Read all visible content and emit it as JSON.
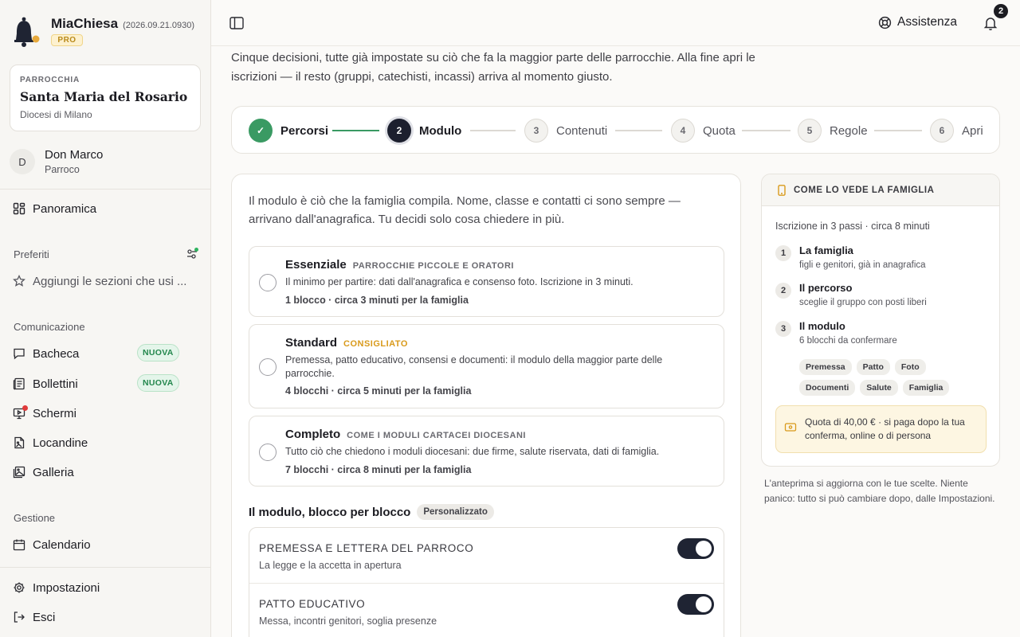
{
  "brand": {
    "name": "MiaChiesa",
    "version": "(2026.09.21.0930)",
    "badge": "PRO",
    "accent": "#1c1f2e",
    "gold": "#e7a93b"
  },
  "parish": {
    "kicker": "PARROCCHIA",
    "name": "Santa Maria del Rosario",
    "diocese": "Diocesi di Milano"
  },
  "user": {
    "initial": "D",
    "name": "Don Marco",
    "role": "Parroco"
  },
  "nav": {
    "overview": "Panoramica",
    "favorites_label": "Preferiti",
    "favorites_add": "Aggiungi le sezioni che usi ...",
    "communication_label": "Comunicazione",
    "communication": [
      {
        "label": "Bacheca",
        "badge": "NUOVA",
        "icon": "message-icon"
      },
      {
        "label": "Bollettini",
        "badge": "NUOVA",
        "icon": "newsletter-icon"
      },
      {
        "label": "Schermi",
        "icon": "screen-icon",
        "dot": true
      },
      {
        "label": "Locandine",
        "icon": "poster-icon"
      },
      {
        "label": "Galleria",
        "icon": "gallery-icon"
      }
    ],
    "management_label": "Gestione",
    "calendar": "Calendario",
    "settings": "Impostazioni",
    "logout": "Esci"
  },
  "topbar": {
    "help": "Assistenza",
    "notifications": "2"
  },
  "intro": "Cinque decisioni, tutte già impostate su ciò che fa la maggior parte delle parrocchie. Alla fine apri le iscrizioni — il resto (gruppi, catechisti, incassi) arriva al momento giusto.",
  "steps": [
    {
      "num": "✓",
      "label": "Percorsi",
      "state": "done"
    },
    {
      "num": "2",
      "label": "Modulo",
      "state": "active"
    },
    {
      "num": "3",
      "label": "Contenuti",
      "state": "todo"
    },
    {
      "num": "4",
      "label": "Quota",
      "state": "todo"
    },
    {
      "num": "5",
      "label": "Regole",
      "state": "todo"
    },
    {
      "num": "6",
      "label": "Apri",
      "state": "todo"
    }
  ],
  "module": {
    "intro": "Il modulo è ciò che la famiglia compila. Nome, classe e contatti ci sono sempre — arrivano dall'anagrafica. Tu decidi solo cosa chiedere in più.",
    "options": [
      {
        "name": "Essenziale",
        "tag": "PARROCCHIE PICCOLE E ORATORI",
        "desc": "Il minimo per partire: dati dall'anagrafica e consenso foto. Iscrizione in 3 minuti.",
        "meta": "1 blocco · circa 3 minuti per la famiglia"
      },
      {
        "name": "Standard",
        "tag": "CONSIGLIATO",
        "desc": "Premessa, patto educativo, consensi e documenti: il modulo della maggior parte delle parrocchie.",
        "meta": "4 blocchi · circa 5 minuti per la famiglia"
      },
      {
        "name": "Completo",
        "tag": "COME I MODULI CARTACEI DIOCESANI",
        "desc": "Tutto ciò che chiedono i moduli diocesani: due firme, salute riservata, dati di famiglia.",
        "meta": "7 blocchi · circa 8 minuti per la famiglia"
      }
    ],
    "blocks_title": "Il modulo, blocco per blocco",
    "blocks_chip": "Personalizzato",
    "blocks": [
      {
        "title": "PREMESSA E LETTERA DEL PARROCO",
        "sub": "La legge e la accetta in apertura",
        "on": true
      },
      {
        "title": "PATTO EDUCATIVO",
        "sub": "Messa, incontri genitori, soglia presenze",
        "on": true
      }
    ]
  },
  "preview": {
    "title": "COME LO VEDE LA FAMIGLIA",
    "subtitle": "Iscrizione in 3 passi · circa 8 minuti",
    "steps": [
      {
        "num": "1",
        "title": "La famiglia",
        "desc": "figli e genitori, già in anagrafica"
      },
      {
        "num": "2",
        "title": "Il percorso",
        "desc": "sceglie il gruppo con posti liberi"
      },
      {
        "num": "3",
        "title": "Il modulo",
        "desc": "6 blocchi da confermare"
      }
    ],
    "chips": [
      "Premessa",
      "Patto",
      "Foto",
      "Documenti",
      "Salute",
      "Famiglia"
    ],
    "fee": "Quota di 40,00 € · si paga dopo la tua conferma, online o di persona",
    "note": "L'anteprima si aggiorna con le tue scelte. Niente panico: tutto si può cambiare dopo, dalle Impostazioni."
  }
}
